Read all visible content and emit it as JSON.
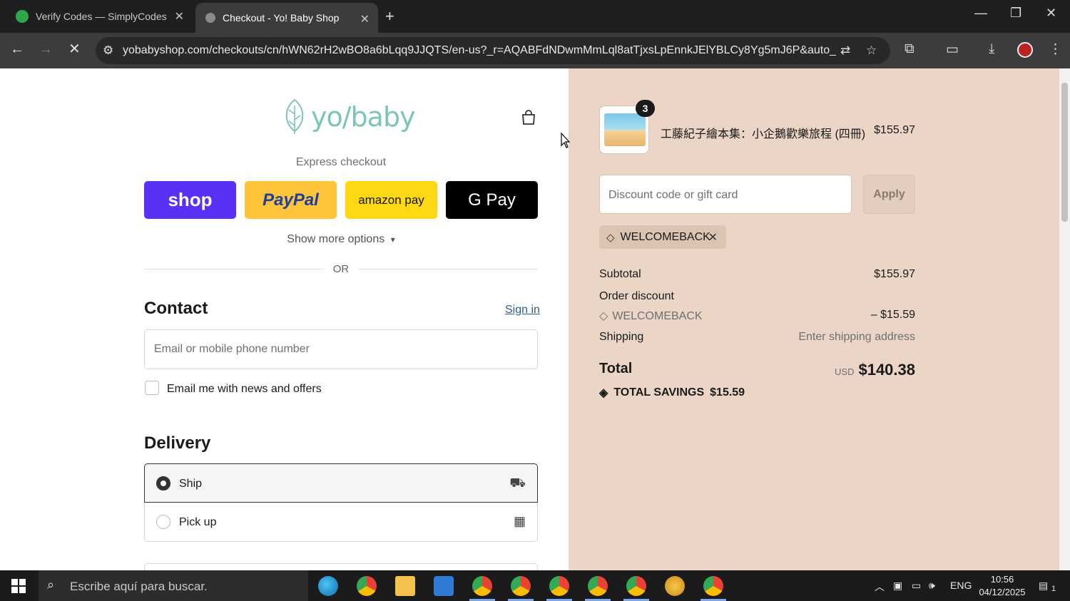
{
  "browser": {
    "tabs": [
      {
        "title": "Verify Codes — SimplyCodes"
      },
      {
        "title": "Checkout - Yo! Baby Shop"
      }
    ],
    "url": "yobabyshop.com/checkouts/cn/hWN62rH2wBO8a6bLqq9JJQTS/en-us?_r=AQABFdNDwmMmLql8atTjxsLpEnnkJElYBLCy8Yg5mJ6P&auto_redirect..."
  },
  "checkout": {
    "logo_text": "yo/baby",
    "express_label": "Express checkout",
    "express_buttons": {
      "shop": "shop",
      "paypal": "PayPal",
      "amazon": "amazon pay",
      "gpay": "G Pay"
    },
    "show_more": "Show more options",
    "or": "OR",
    "contact_title": "Contact",
    "sign_in": "Sign in",
    "email_placeholder": "Email or mobile phone number",
    "news_label": "Email me with news and offers",
    "delivery_title": "Delivery",
    "delivery_options": [
      {
        "label": "Ship",
        "selected": true
      },
      {
        "label": "Pick up",
        "selected": false
      }
    ]
  },
  "summary": {
    "item": {
      "name": "工藤紀子繪本集：小企鵝歡樂旅程 (四冊)",
      "price": "$155.97",
      "quantity": "3"
    },
    "discount_placeholder": "Discount code or gift card",
    "apply_label": "Apply",
    "applied_code": "WELCOMEBACK",
    "subtotal_label": "Subtotal",
    "subtotal_value": "$155.97",
    "order_discount_label": "Order discount",
    "discount_code": "WELCOMEBACK",
    "discount_value": "– $15.59",
    "shipping_label": "Shipping",
    "shipping_value": "Enter shipping address",
    "total_label": "Total",
    "currency": "USD",
    "total_value": "$140.38",
    "savings_label": "TOTAL SAVINGS",
    "savings_value": "$15.59"
  },
  "taskbar": {
    "search_placeholder": "Escribe aquí para buscar.",
    "language": "ENG",
    "time": "10:56",
    "date": "04/12/2025",
    "notification_count": "1"
  }
}
